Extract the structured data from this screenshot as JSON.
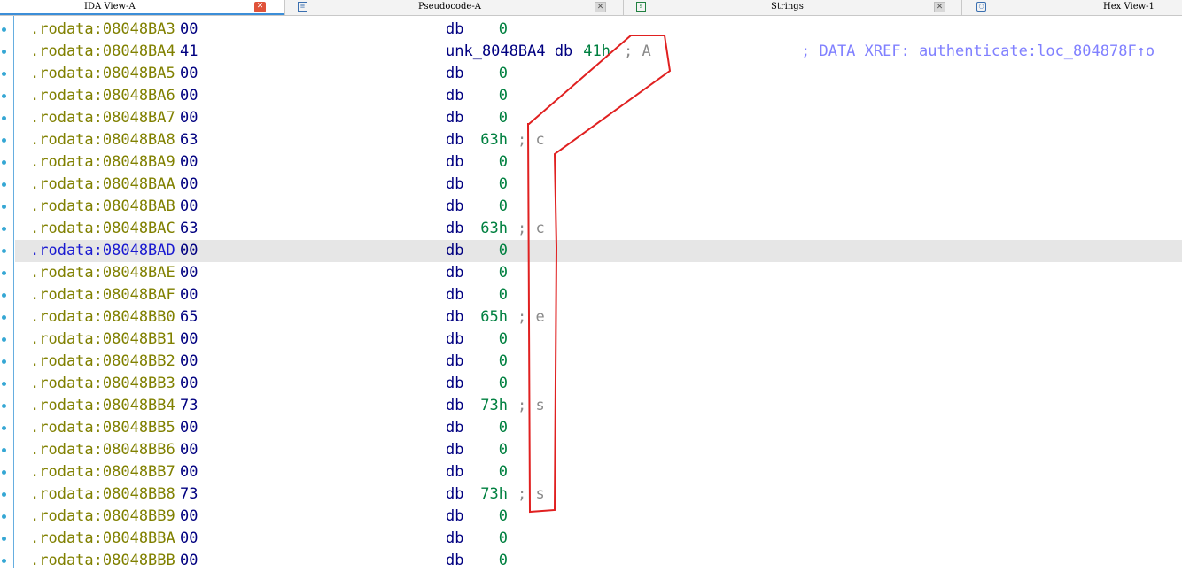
{
  "tabs": [
    {
      "label": "IDA View-A",
      "active": true
    },
    {
      "label": "Pseudocode-A",
      "active": false
    },
    {
      "label": "Strings",
      "active": false
    },
    {
      "label": "Hex View-1",
      "active": false
    }
  ],
  "rows": [
    {
      "addr": ".rodata:08048BA3",
      "hex": "00",
      "ins": "db",
      "val": "0",
      "cmt": ""
    },
    {
      "addr": ".rodata:08048BA4",
      "hex": "41",
      "ins": "unk_8048BA4 db",
      "val": "41h",
      "cmt": "; A",
      "xref": "; DATA XREF: authenticate:loc_804878F↑o"
    },
    {
      "addr": ".rodata:08048BA5",
      "hex": "00",
      "ins": "db",
      "val": "0",
      "cmt": ""
    },
    {
      "addr": ".rodata:08048BA6",
      "hex": "00",
      "ins": "db",
      "val": "0",
      "cmt": ""
    },
    {
      "addr": ".rodata:08048BA7",
      "hex": "00",
      "ins": "db",
      "val": "0",
      "cmt": ""
    },
    {
      "addr": ".rodata:08048BA8",
      "hex": "63",
      "ins": "db",
      "val": "63h",
      "cmt": "; c"
    },
    {
      "addr": ".rodata:08048BA9",
      "hex": "00",
      "ins": "db",
      "val": "0",
      "cmt": ""
    },
    {
      "addr": ".rodata:08048BAA",
      "hex": "00",
      "ins": "db",
      "val": "0",
      "cmt": ""
    },
    {
      "addr": ".rodata:08048BAB",
      "hex": "00",
      "ins": "db",
      "val": "0",
      "cmt": ""
    },
    {
      "addr": ".rodata:08048BAC",
      "hex": "63",
      "ins": "db",
      "val": "63h",
      "cmt": "; c"
    },
    {
      "addr": ".rodata:08048BAD",
      "hex": "00",
      "ins": "db",
      "val": "0",
      "cmt": "",
      "selected": true
    },
    {
      "addr": ".rodata:08048BAE",
      "hex": "00",
      "ins": "db",
      "val": "0",
      "cmt": ""
    },
    {
      "addr": ".rodata:08048BAF",
      "hex": "00",
      "ins": "db",
      "val": "0",
      "cmt": ""
    },
    {
      "addr": ".rodata:08048BB0",
      "hex": "65",
      "ins": "db",
      "val": "65h",
      "cmt": "; e"
    },
    {
      "addr": ".rodata:08048BB1",
      "hex": "00",
      "ins": "db",
      "val": "0",
      "cmt": ""
    },
    {
      "addr": ".rodata:08048BB2",
      "hex": "00",
      "ins": "db",
      "val": "0",
      "cmt": ""
    },
    {
      "addr": ".rodata:08048BB3",
      "hex": "00",
      "ins": "db",
      "val": "0",
      "cmt": ""
    },
    {
      "addr": ".rodata:08048BB4",
      "hex": "73",
      "ins": "db",
      "val": "73h",
      "cmt": "; s"
    },
    {
      "addr": ".rodata:08048BB5",
      "hex": "00",
      "ins": "db",
      "val": "0",
      "cmt": ""
    },
    {
      "addr": ".rodata:08048BB6",
      "hex": "00",
      "ins": "db",
      "val": "0",
      "cmt": ""
    },
    {
      "addr": ".rodata:08048BB7",
      "hex": "00",
      "ins": "db",
      "val": "0",
      "cmt": ""
    },
    {
      "addr": ".rodata:08048BB8",
      "hex": "73",
      "ins": "db",
      "val": "73h",
      "cmt": "; s"
    },
    {
      "addr": ".rodata:08048BB9",
      "hex": "00",
      "ins": "db",
      "val": "0",
      "cmt": ""
    },
    {
      "addr": ".rodata:08048BBA",
      "hex": "00",
      "ins": "db",
      "val": "0",
      "cmt": ""
    },
    {
      "addr": ".rodata:08048BBB",
      "hex": "00",
      "ins": "db",
      "val": "0",
      "cmt": ""
    }
  ],
  "colors": {
    "annotation": "#e02020",
    "selection": "#e6e6e6",
    "address": "#808000"
  }
}
